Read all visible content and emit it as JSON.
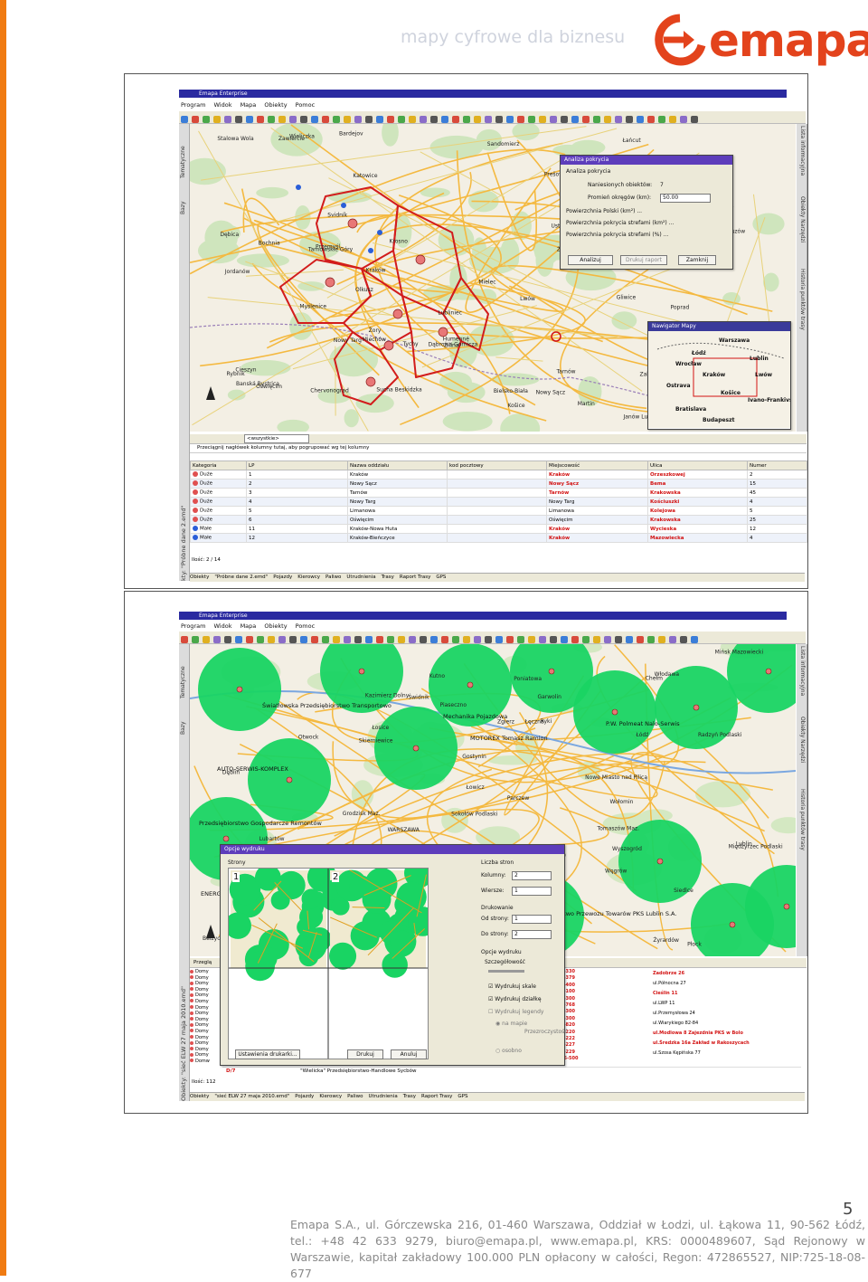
{
  "header": {
    "tagline": "mapy cyfrowe dla biznesu",
    "logo_text": "emapa"
  },
  "colors": {
    "brand_orange": "#f07b12",
    "logo_red": "#e3431c",
    "route_red": "#d21c1c",
    "coverage_green": "#19d463",
    "window_title_blue": "#2a2aa0",
    "dialog_title_purple": "#5d3dbb"
  },
  "screenshot1": {
    "window_title": "Emapa Enterprise",
    "menu": [
      "Program",
      "Widok",
      "Mapa",
      "Obiekty",
      "Pomoc"
    ],
    "left_tabs": [
      "Tematyczne",
      "Bazy"
    ],
    "right_tabs": [
      "Lista informacyjna",
      "Obiekty Narzędzi",
      "Historia punktów trasy"
    ],
    "map_labels": [
      "Lubliniec",
      "Tarnowskie Góry",
      "Zawiercie",
      "Gliwice",
      "Sosnowiec",
      "Katowice",
      "Dąbrowa Górnicza",
      "Olkusz",
      "Miechów",
      "Jędrzejów",
      "Chmielnik",
      "Sandomierz",
      "Stalowa Wola",
      "Janów Lubelski",
      "Kraków",
      "Tarnów",
      "Mielec",
      "Rzeszów",
      "Jasło",
      "Krosno",
      "Sanok",
      "Przemyśl",
      "Nowy Sącz",
      "Nowy Targ",
      "Zakopane",
      "Żywiec",
      "Bielsko-Biała",
      "Cieszyn",
      "Wodzisław Śląski",
      "Rybnik",
      "Żory",
      "Tychy",
      "Oświęcim",
      "Limanowa",
      "Gorlice",
      "Dębica",
      "Bochnia",
      "Wieliczka",
      "Myślenice",
      "Sucha Beskidzka",
      "Jordanów",
      "Rabka-Zdrój",
      "Poprad",
      "Martin",
      "Žilina",
      "Banská Bystrica",
      "Humenné",
      "Svidník",
      "Bardejov",
      "Prešov",
      "Košice",
      "Lublin",
      "Lwów",
      "Łańcut",
      "Brzozów",
      "Ustrzyki Dolne",
      "Chervonograd"
    ],
    "coverage_dialog": {
      "title": "Analiza pokrycia",
      "section": "Analiza pokrycia",
      "count_label": "Naniesionych obiektów:",
      "count_value": "7",
      "radius_label": "Promień okręgów (km):",
      "radius_value": "50.00",
      "rows": [
        "Powierzchnia Polski (km²) ...",
        "Powierzchnia pokrycia strefami (km²) ...",
        "Powierzchnia pokrycia strefami (%) ..."
      ],
      "buttons": [
        "Analizuj",
        "Drukuj raport",
        "Zamknij"
      ]
    },
    "navigator": {
      "title": "Nawigator Mapy",
      "labels": [
        "Warszawa",
        "Łódź",
        "Lublin",
        "Wrocław",
        "Kraków",
        "Lwów",
        "Ostrava",
        "Košice",
        "Bratislava",
        "Ivano-Frankivsk",
        "Budapeszt"
      ]
    },
    "grid": {
      "group_hint": "Przeciągnij nagłówek kolumny tutaj, aby pogrupować wg tej kolumny",
      "filter_value": "<wszystkie>",
      "columns": [
        "Kategoria",
        "LP",
        "Nazwa oddziału",
        "kod pocztowy",
        "Miejscowość",
        "Ulica",
        "Numer"
      ],
      "rows": [
        [
          "Duże",
          "1",
          "Kraków",
          "",
          "Kraków",
          "Orzeszkowej",
          "2"
        ],
        [
          "Duże",
          "2",
          "Nowy Sącz",
          "",
          "Nowy Sącz",
          "Bema",
          "15"
        ],
        [
          "Duże",
          "3",
          "Tarnów",
          "",
          "Tarnów",
          "Krakowska",
          "45"
        ],
        [
          "Duże",
          "4",
          "Nowy Targ",
          "",
          "Nowy Targ",
          "Kościuszki",
          "4"
        ],
        [
          "Duże",
          "5",
          "Limanowa",
          "",
          "Limanowa",
          "Kolejowa",
          "5"
        ],
        [
          "Duże",
          "6",
          "Oświęcim",
          "",
          "Oświęcim",
          "Krakowska",
          "25"
        ],
        [
          "Małe",
          "11",
          "Kraków-Nowa Huta",
          "",
          "Kraków",
          "Wycieska",
          "12"
        ],
        [
          "Małe",
          "12",
          "Kraków-Bieńczyce",
          "",
          "Kraków",
          "Mazowiecka",
          "4"
        ]
      ],
      "count_label": "Ilość: 2 / 14"
    },
    "left_grid_tab": "Obiekty: \"Próbne dane 2.emd\"",
    "status_tabs": [
      "Obiekty",
      "\"Próbne dane 2.emd\"",
      "Pojazdy",
      "Kierowcy",
      "Paliwo",
      "Utrudnienia",
      "Trasy",
      "Raport Trasy",
      "GPS"
    ]
  },
  "screenshot2": {
    "window_title": "Emapa Enterprise",
    "menu": [
      "Program",
      "Widok",
      "Mapa",
      "Obiekty",
      "Pomoc"
    ],
    "left_tabs": [
      "Tematyczne",
      "Bazy"
    ],
    "right_tabs": [
      "Lista informacyjna",
      "Obiekty Narzędzi",
      "Historia punktów trasy"
    ],
    "map_labels": [
      "Gostynin",
      "Płock",
      "Wyszogród",
      "Legionowo",
      "Wołomin",
      "Sokołów Podlaski",
      "WARSZAWA",
      "Łowicz",
      "Żyrardów",
      "Grodzisk Maz.",
      "Piaseczno",
      "Otwock",
      "Garwolin",
      "Mińsk Mazowiecki",
      "Siedlce",
      "Węgrów",
      "Łosice",
      "Biała Podlaska",
      "Międzyrzec Podlaski",
      "Radzyń Podlaski",
      "Łuków",
      "Ryki",
      "Dęblin",
      "Puławy",
      "Kozienice",
      "Grójec",
      "Białobrzegi",
      "Rawa Mazowiecka",
      "Skierniewice",
      "Łódź",
      "Zgierz",
      "Ozorków",
      "Kutno",
      "Łęczyca",
      "Tomaszów Maz.",
      "Nowe Miasto nad Pilicą",
      "Lubartów",
      "Łęczna",
      "Lublin",
      "Świdnik",
      "Bełżyce",
      "Poniatowa",
      "Nałęczów",
      "Kazimierz Dolny",
      "Włodawa",
      "Parczew",
      "Chełm",
      "Ostrów Lubelski"
    ],
    "business_labels": [
      "Światłowska Przedsiębiorstwo Transportowo",
      "AUTO-SERWIS-KOMPLEX",
      "Mechanika Pojazdowa",
      "P.W. Polmeat Nalo-Serwis",
      "Przedsiębiorstwo Przewozu Towarów PKS Lublin S.A.",
      "MOTOREX Tomasz Ramion",
      "Przedsiębiorstwo Gospodarcze Remontów",
      "ENERGO"
    ],
    "print_dialog": {
      "title": "Opcje wydruku",
      "pages_label": "Strony",
      "page_numbers": [
        "1",
        "2"
      ],
      "pages_group": "Liczba stron",
      "columns_label": "Kolumny:",
      "columns_value": "2",
      "rows_label": "Wiersze:",
      "rows_value": "1",
      "printing_group": "Drukowanie",
      "from_label": "Od strony:",
      "from_value": "1",
      "to_label": "Do strony:",
      "to_value": "2",
      "print_options": "Opcje wydruku",
      "detail_label": "Szczegółowość",
      "check_scale": "Wydrukuj skale",
      "check_marks": "Wydrukuj działkę",
      "check_legend": "Wydrukuj legendy",
      "radio_on_map": "na mapie",
      "transparency_label": "Przezroczystość",
      "radio_separately": "osobno",
      "buttons": [
        "Ustawienia drukarki...",
        "Drukuj",
        "Anuluj"
      ]
    },
    "grid": {
      "header_first": "Przeglą",
      "left_rows": [
        "Domy",
        "Domy",
        "Domy",
        "Domy",
        "Domy",
        "Domy",
        "Domy",
        "Domy",
        "Domy",
        "Domy",
        "Domy",
        "Domy",
        "Domy",
        "Domy",
        "Domy",
        "Domw"
      ],
      "code_col": [
        "3-330",
        "0-379",
        "3-400",
        "3-100",
        "4-300",
        "1-768",
        "5-300",
        "1-300",
        "1-820",
        "1-220",
        "1-222",
        "1-227",
        "1-229",
        "56-500"
      ],
      "street_col": [
        "Zadobrze 26",
        "ul.Północna 27",
        "Cieślin 11",
        "ul.LWP 11",
        "ul.Przemysłowa 24",
        "ul.Wiarykiego 82-84",
        "ul.Modlowa 8 Zajezdnia PKS w Bolo",
        "ul.Średzka 16a Zakład w Rakoszycach",
        "ul.Szosa Kępińska 77"
      ],
      "bottom_row_code": "D/7",
      "bottom_row_name": "\"Wielicka\" Przedsiębiorstwo-Handlowe Sycbów",
      "count_label": "Ilość: 112"
    },
    "left_grid_tab": "Obiekty: \"sieć ELW 27 maja 2010.emd\"",
    "status_tabs": [
      "Obiekty",
      "\"sieć ELW 27 maja 2010.emd\"",
      "Pojazdy",
      "Kierowcy",
      "Paliwo",
      "Utrudnienia",
      "Trasy",
      "Raport Trasy",
      "GPS"
    ]
  },
  "page_number": "5",
  "footer": "Emapa S.A., ul. Górczewska 216, 01-460 Warszawa, Oddział w Łodzi, ul. Łąkowa 11, 90-562 Łódź, tel.: +48 42 633 9279, biuro@emapa.pl, www.emapa.pl, KRS: 0000489607, Sąd Rejonowy w Warszawie, kapitał zakładowy 100.000 PLN opłacony w całości, Regon: 472865527, NIP:725-18-08-677"
}
